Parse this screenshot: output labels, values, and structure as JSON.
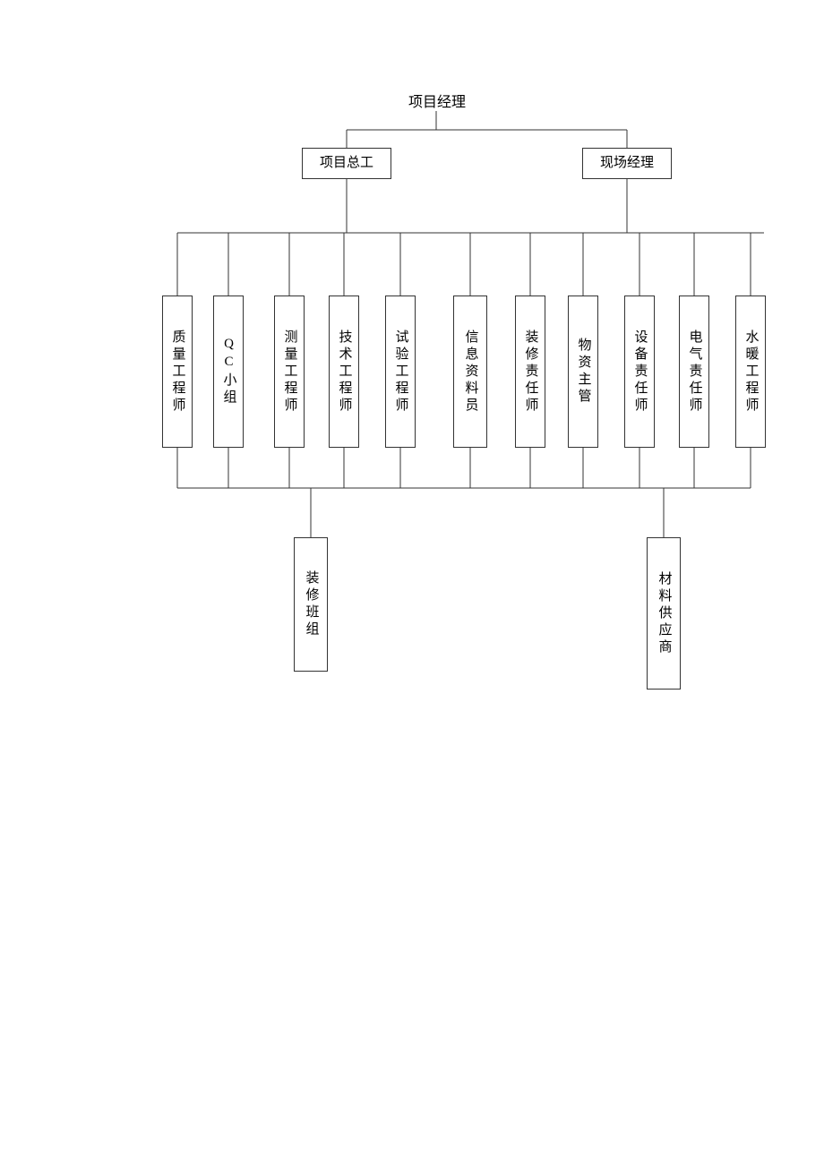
{
  "top": {
    "label": "项目经理"
  },
  "level2": {
    "left": "项目总工",
    "right": "现场经理"
  },
  "level3": [
    "质量工程师",
    "QC小组",
    "测量工程师",
    "技术工程师",
    "试验工程师",
    "信息资料员",
    "装修责任师",
    "物资主管",
    "设备责任师",
    "电气责任师",
    "水暖工程师"
  ],
  "level4": {
    "left": "装修班组",
    "right": "材料供应商"
  }
}
